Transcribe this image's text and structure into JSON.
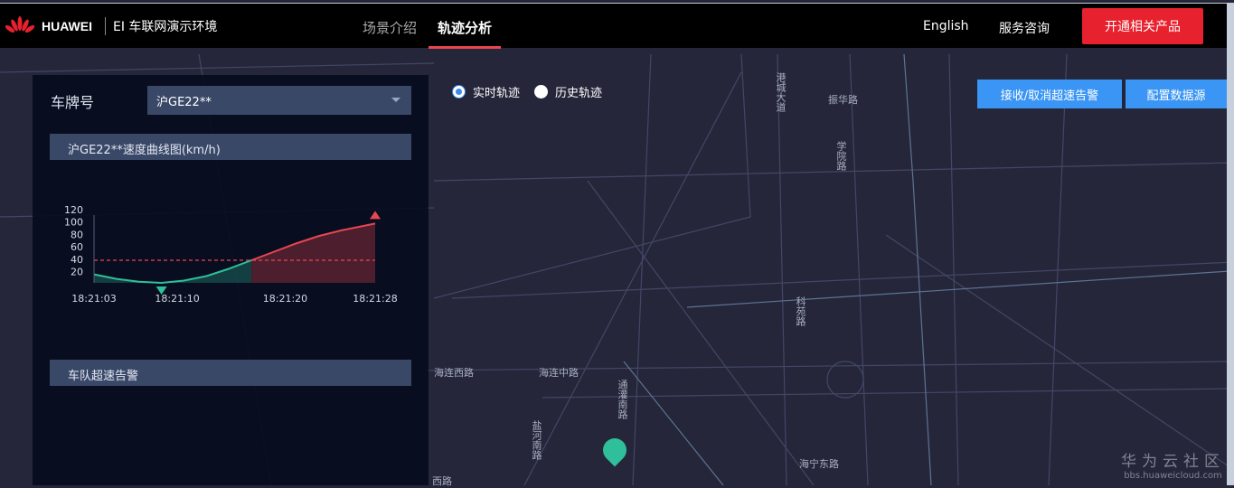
{
  "header": {
    "brand": "HUAWEI",
    "env_title": "EI 车联网演示环境",
    "nav": [
      {
        "label": "场景介绍",
        "active": false
      },
      {
        "label": "轨迹分析",
        "active": true
      }
    ],
    "language": "English",
    "consult": "服务咨询",
    "cta": "开通相关产品"
  },
  "panel": {
    "plate_label": "车牌号",
    "plate_value": "沪GE22**",
    "chart_title": "沪GE22**速度曲线图(km/h)",
    "alarm_title": "车队超速告警"
  },
  "track_mode": {
    "options": [
      {
        "label": "实时轨迹",
        "selected": true
      },
      {
        "label": "历史轨迹",
        "selected": false
      }
    ]
  },
  "actions": {
    "toggle_alarm": "接收/取消超速告警",
    "config_source": "配置数据源"
  },
  "map": {
    "labels": [
      "港城大道",
      "振华路",
      "学院路",
      "科苑路",
      "海连西路",
      "海连中路",
      "通灌南路",
      "盐河南路",
      "海宁东路",
      "西路"
    ]
  },
  "watermark": {
    "name": "华为云社区",
    "url": "bbs.huaweicloud.com"
  },
  "colors": {
    "accent_red": "#e8212e",
    "blue": "#3a95f4",
    "normal": "#2fbf9a",
    "over": "#e8474f"
  },
  "chart_data": {
    "type": "area",
    "title": "沪GE22**速度曲线图(km/h)",
    "xlabel": "",
    "ylabel": "km/h",
    "ylim": [
      0,
      120
    ],
    "yticks": [
      20,
      40,
      60,
      80,
      100,
      120
    ],
    "xticks": [
      "18:21:03",
      "18:21:10",
      "18:21:20",
      "18:21:28"
    ],
    "x_range_seconds": [
      3,
      28
    ],
    "threshold": 40,
    "series": [
      {
        "name": "speed",
        "x": [
          3,
          5,
          7,
          9,
          11,
          13,
          15,
          17,
          19,
          21,
          23,
          25,
          28
        ],
        "values": [
          15,
          7,
          2,
          0,
          4,
          12,
          25,
          40,
          55,
          70,
          83,
          93,
          105
        ]
      }
    ],
    "markers": {
      "min": {
        "x": 9,
        "value": 0
      },
      "max": {
        "x": 28,
        "value": 105
      }
    },
    "grid": false
  }
}
